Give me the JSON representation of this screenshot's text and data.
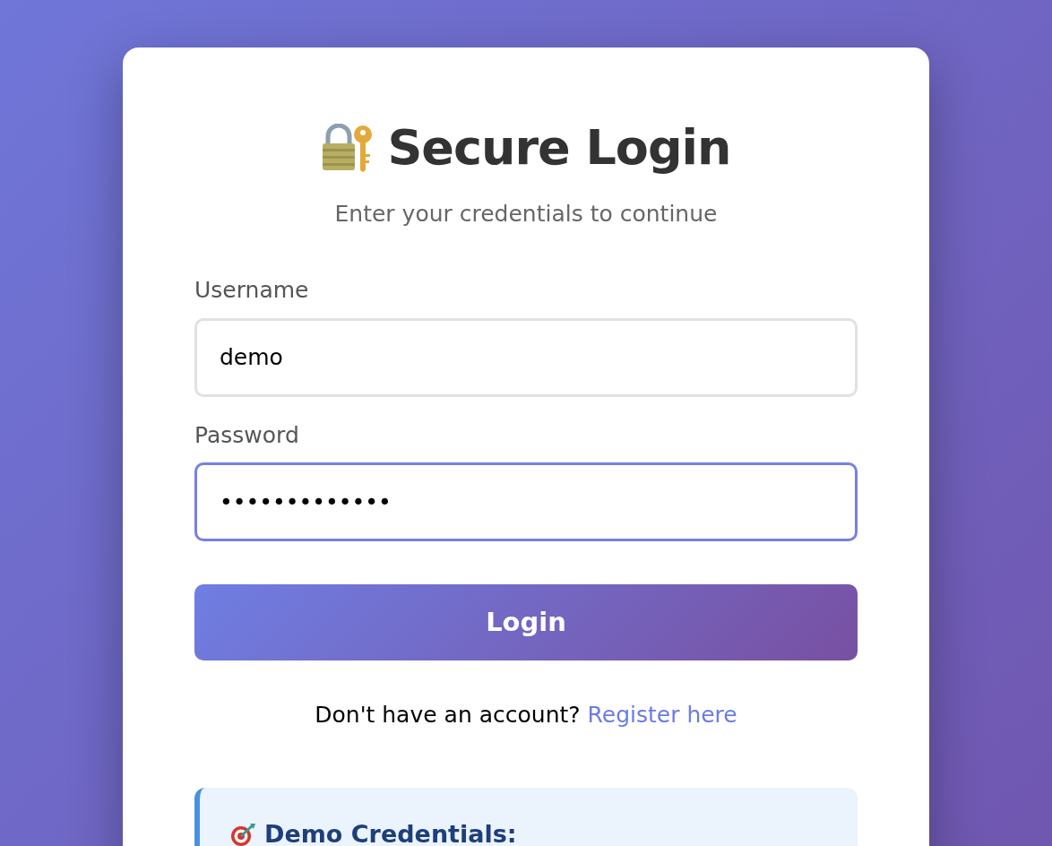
{
  "title": "Secure Login",
  "subtitle": "Enter your credentials to continue",
  "fields": [
    {
      "label": "Username",
      "value": "demo",
      "focused": false
    },
    {
      "label": "Password",
      "value": "•••••••••••••",
      "focused": true
    }
  ],
  "submit_button": "Login",
  "register_prompt": {
    "text": "Don't have an account?",
    "link": "Register here"
  },
  "demo_box": {
    "title": "Demo Credentials:"
  }
}
